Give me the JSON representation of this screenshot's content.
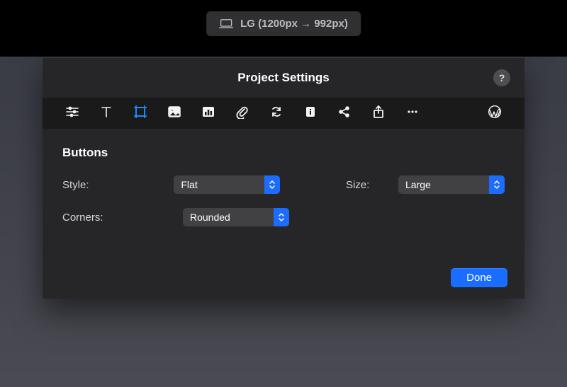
{
  "viewport_pill": {
    "icon": "laptop-icon",
    "label": "LG (1200px → 992px)"
  },
  "panel": {
    "title": "Project Settings",
    "help_tooltip": "?",
    "toolbar_icons": [
      "sliders-icon",
      "text-icon",
      "crop-icon",
      "image-icon",
      "chart-icon",
      "attachment-icon",
      "recycle-icon",
      "info-icon",
      "share-icon",
      "upload-icon",
      "more-icon",
      "wordpress-icon"
    ],
    "toolbar_selected_index": 2
  },
  "buttons_section": {
    "title": "Buttons",
    "style_label": "Style:",
    "style_value": "Flat",
    "size_label": "Size:",
    "size_value": "Large",
    "corners_label": "Corners:",
    "corners_value": "Rounded"
  },
  "footer": {
    "done_label": "Done"
  },
  "colors": {
    "panel_bg": "#262628",
    "toolbar_bg": "#1a1a1b",
    "accent_blue": "#196eff",
    "select_bg": "#414143",
    "selected_icon": "#1b8cff"
  }
}
